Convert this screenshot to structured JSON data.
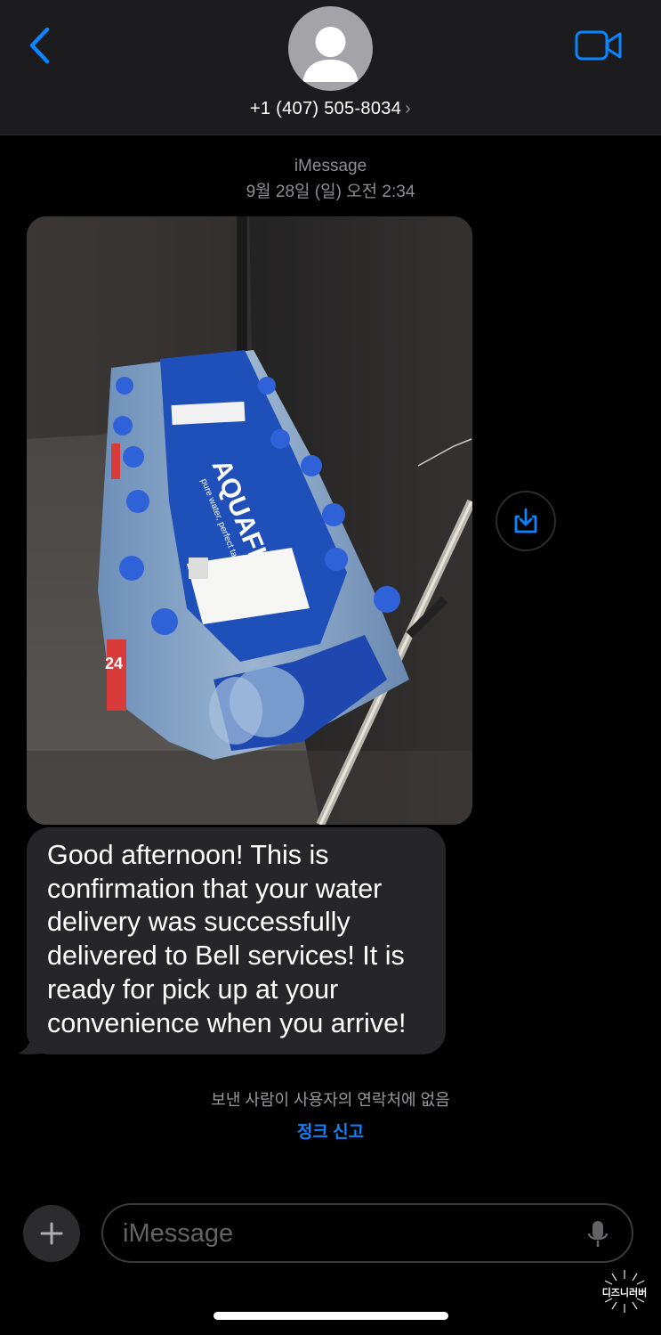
{
  "header": {
    "contact_name": "+1 (407) 505-8034",
    "contact_chevron": "›",
    "back_icon": "chevron-left-icon",
    "video_icon": "video-camera-icon",
    "avatar_icon": "person-silhouette-icon"
  },
  "meta": {
    "service": "iMessage",
    "timestamp": "9월 28일 (일) 오전 2:34"
  },
  "photo": {
    "brand_label": "AQUAFINA",
    "tagline": "pure water, perfect taste",
    "count_label": "24",
    "save_icon": "download-tray-icon"
  },
  "message": {
    "text": "Good afternoon! This is confirmation that your water delivery was successfully delivered to Bell services! It is ready for pick up at your convenience when you arrive!"
  },
  "notice": {
    "unknown_sender": "보낸 사람이 사용자의 연락처에 없음",
    "report_junk": "정크 신고"
  },
  "composer": {
    "placeholder": "iMessage",
    "plus_icon": "plus-icon",
    "mic_icon": "microphone-icon"
  },
  "watermark": {
    "text": "디즈니러버"
  },
  "colors": {
    "accent": "#0a84ff",
    "header_bg": "#1c1c1e",
    "bubble_bg": "#262628",
    "secondary_text": "#8e8e93"
  }
}
